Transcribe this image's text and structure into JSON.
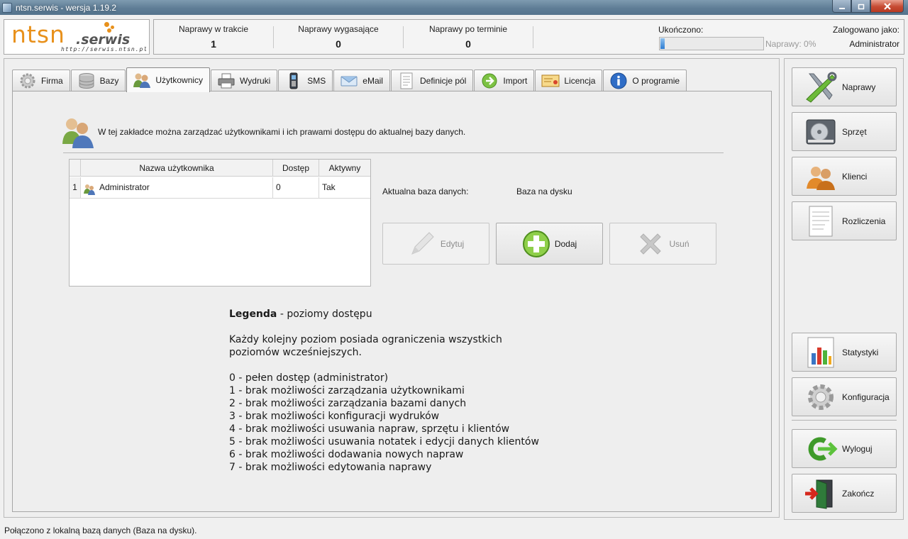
{
  "window": {
    "title": "ntsn.serwis - wersja 1.19.2"
  },
  "logo": {
    "text_main": "ntsn",
    "text_sub": ".serwis",
    "url": "http://serwis.ntsn.pl"
  },
  "stats": [
    {
      "label": "Naprawy w trakcie",
      "value": "1"
    },
    {
      "label": "Naprawy wygasające",
      "value": "0"
    },
    {
      "label": "Naprawy po terminie",
      "value": "0"
    }
  ],
  "progress": {
    "label": "Ukończono:",
    "text": "Naprawy: 0%",
    "fraction": 0.0
  },
  "login": {
    "label": "Zalogowano jako:",
    "user": "Administrator"
  },
  "tabs": [
    {
      "label": "Firma",
      "icon": "gear-icon"
    },
    {
      "label": "Bazy",
      "icon": "database-icon"
    },
    {
      "label": "Użytkownicy",
      "icon": "users-icon",
      "active": true
    },
    {
      "label": "Wydruki",
      "icon": "printer-icon"
    },
    {
      "label": "SMS",
      "icon": "phone-icon"
    },
    {
      "label": "eMail",
      "icon": "mail-icon"
    },
    {
      "label": "Definicje pól",
      "icon": "document-icon"
    },
    {
      "label": "Import",
      "icon": "import-icon"
    },
    {
      "label": "Licencja",
      "icon": "certificate-icon"
    },
    {
      "label": "O programie",
      "icon": "info-icon"
    }
  ],
  "users_tab": {
    "intro": "W tej zakładce można zarządzać użytkownikami i ich prawami dostępu do aktualnej bazy danych.",
    "table": {
      "columns": [
        "Nazwa użytkownika",
        "Dostęp",
        "Aktywny"
      ],
      "rows": [
        {
          "num": "1",
          "name": "Administrator",
          "access": "0",
          "active": "Tak"
        }
      ]
    },
    "current_db_label": "Aktualna baza danych:",
    "current_db_value": "Baza na dysku",
    "buttons": {
      "edit": "Edytuj",
      "add": "Dodaj",
      "delete": "Usuń"
    },
    "legend": {
      "title": "Legenda",
      "title_suffix": " - poziomy dostępu",
      "description": "Każdy kolejny poziom posiada ograniczenia wszystkich poziomów wcześniejszych.",
      "items": [
        "0 - pełen dostęp (administrator)",
        "1 - brak możliwości zarządzania użytkownikami",
        "2 - brak możliwości zarządzania bazami danych",
        "3 - brak możliwości konfiguracji wydruków",
        "4 - brak możliwości usuwania napraw, sprzętu i klientów",
        "5 - brak możliwości usuwania notatek i edycji danych klientów",
        "6 - brak możliwości dodawania nowych napraw",
        "7 - brak możliwości edytowania naprawy"
      ]
    }
  },
  "sidebar": {
    "buttons": [
      {
        "label": "Naprawy",
        "icon": "tools-icon"
      },
      {
        "label": "Sprzęt",
        "icon": "hard-drive-icon"
      },
      {
        "label": "Klienci",
        "icon": "clients-icon"
      },
      {
        "label": "Rozliczenia",
        "icon": "invoice-icon"
      },
      {
        "label": "Statystyki",
        "icon": "chart-icon"
      },
      {
        "label": "Konfiguracja",
        "icon": "gear-icon"
      },
      {
        "label": "Wyloguj",
        "icon": "logout-icon"
      },
      {
        "label": "Zakończ",
        "icon": "exit-door-icon"
      }
    ]
  },
  "statusbar": {
    "text": "Połączono z lokalną bazą danych (Baza na dysku)."
  }
}
